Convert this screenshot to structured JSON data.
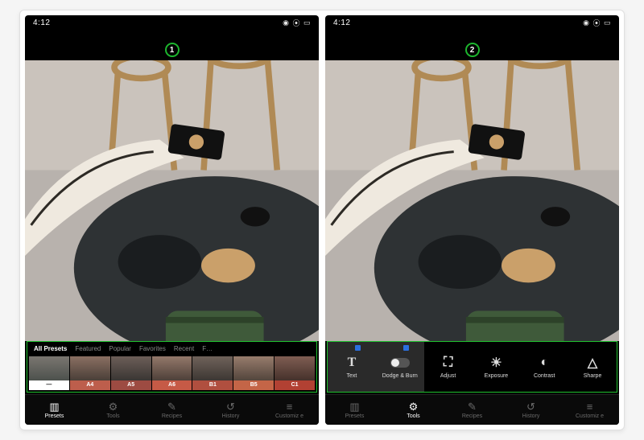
{
  "status": {
    "time": "4:12",
    "wifi": "wifi",
    "battery": "battery"
  },
  "steps": {
    "one": "1",
    "two": "2"
  },
  "preset_tabs": {
    "all": "All Presets",
    "featured": "Featured",
    "popular": "Popular",
    "favorites": "Favorites",
    "recent": "Recent",
    "for": "F…"
  },
  "presets": [
    {
      "label": "—",
      "tint": "#ffffff"
    },
    {
      "label": "A4",
      "tint": "#bd5e4c"
    },
    {
      "label": "A5",
      "tint": "#9d4b42"
    },
    {
      "label": "A6",
      "tint": "#c65a46"
    },
    {
      "label": "B1",
      "tint": "#b04f3f"
    },
    {
      "label": "B5",
      "tint": "#c46547"
    },
    {
      "label": "C1",
      "tint": "#b24133"
    }
  ],
  "tools": {
    "text": "Text",
    "dodge": "Dodge & Burn",
    "adjust": "Adjust",
    "exposure": "Exposure",
    "contrast": "Contrast",
    "sharpen": "Sharpe"
  },
  "nav": {
    "presets": "Presets",
    "tools": "Tools",
    "recipes": "Recipes",
    "history": "History",
    "customize": "Customiz e"
  }
}
